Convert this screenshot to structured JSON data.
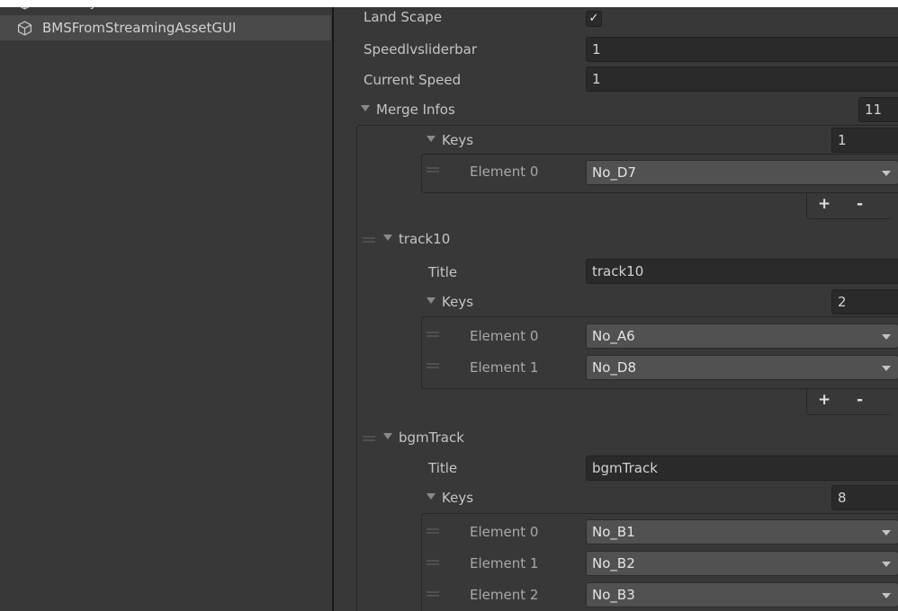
{
  "hierarchy": {
    "items": [
      {
        "label": "EventSystem",
        "icon": "gameobject-cube-icon"
      },
      {
        "label": "BMSFromStreamingAssetGUI",
        "icon": "gameobject-cube-icon",
        "selected": true
      }
    ]
  },
  "inspector": {
    "land_scape": {
      "label": "Land Scape",
      "checked": true,
      "check_glyph": "✓"
    },
    "speed_slider": {
      "label": "Speedlvsliderbar",
      "value": "1"
    },
    "current_speed": {
      "label": "Current Speed",
      "value": "1"
    },
    "merge_infos": {
      "label": "Merge Infos",
      "count": "11",
      "elements": [
        {
          "keys_label": "Keys",
          "keys_count": "1",
          "keys": [
            {
              "label": "Element 0",
              "value": "No_D7"
            }
          ]
        },
        {
          "header": "track10",
          "title_label": "Title",
          "title_value": "track10",
          "keys_label": "Keys",
          "keys_count": "2",
          "keys": [
            {
              "label": "Element 0",
              "value": "No_A6"
            },
            {
              "label": "Element 1",
              "value": "No_D8"
            }
          ]
        },
        {
          "header": "bgmTrack",
          "title_label": "Title",
          "title_value": "bgmTrack",
          "keys_label": "Keys",
          "keys_count": "8",
          "keys": [
            {
              "label": "Element 0",
              "value": "No_B1"
            },
            {
              "label": "Element 1",
              "value": "No_B2"
            },
            {
              "label": "Element 2",
              "value": "No_B3"
            }
          ]
        }
      ]
    },
    "add_label": "+",
    "remove_label": "-"
  },
  "colors": {
    "panel_bg": "#383838",
    "field_bg": "#2a2a2a",
    "dropdown_bg": "#515151",
    "selected_row": "#4a4a4a",
    "text": "#c4c4c4"
  }
}
